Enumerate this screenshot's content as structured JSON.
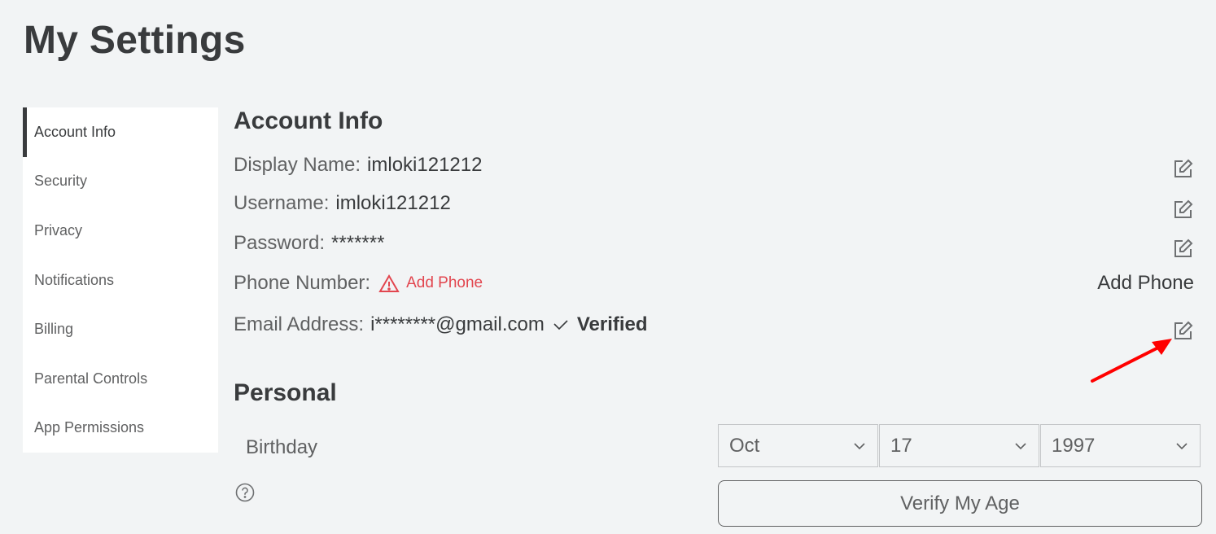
{
  "page": {
    "title": "My Settings"
  },
  "sidebar": {
    "items": [
      {
        "label": "Account Info",
        "active": true
      },
      {
        "label": "Security"
      },
      {
        "label": "Privacy"
      },
      {
        "label": "Notifications"
      },
      {
        "label": "Billing"
      },
      {
        "label": "Parental Controls"
      },
      {
        "label": "App Permissions"
      }
    ]
  },
  "account_info": {
    "title": "Account Info",
    "display_name": {
      "label": "Display Name:",
      "value": "imloki121212",
      "icon": "edit-icon"
    },
    "username": {
      "label": "Username:",
      "value": "imloki121212",
      "icon": "edit-icon"
    },
    "password": {
      "label": "Password:",
      "value": "*******",
      "icon": "edit-icon"
    },
    "phone": {
      "label": "Phone Number:",
      "warning_label": "Add Phone",
      "warning_icon": "warning-triangle-icon",
      "button_label": "Add Phone"
    },
    "email": {
      "label": "Email Address:",
      "value": "i********@gmail.com",
      "status_icon": "checkmark-icon",
      "status": "Verified",
      "icon": "edit-icon"
    }
  },
  "personal": {
    "title": "Personal",
    "birthday": {
      "label": "Birthday",
      "help_icon": "question-circle-icon",
      "month": "Oct",
      "day": "17",
      "year": "1997"
    },
    "verify_button": "Verify My Age"
  },
  "colors": {
    "background": "#f2f4f5",
    "text_primary": "#393b3d",
    "text_secondary": "#606162",
    "warning": "#e2464f",
    "annotation_arrow": "#ff0000"
  }
}
